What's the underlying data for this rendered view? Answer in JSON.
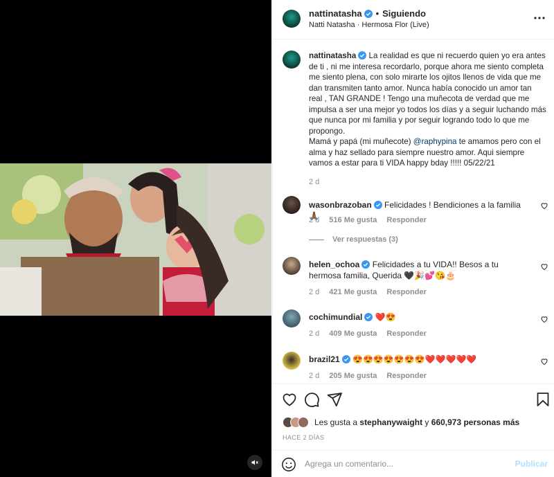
{
  "media": {
    "mute_icon": "speaker-muted-icon"
  },
  "header": {
    "username": "nattinatasha",
    "separator": "•",
    "follow_label": "Siguiendo",
    "audio": "Natti Natasha · Hermosa Flor (Live)",
    "more_icon": "more-horizontal-icon"
  },
  "caption": {
    "username": "nattinatasha",
    "text_before_mention": "La realidad es que ni recuerdo quien yo era antes de ti , ni me interesa recordarlo, porque ahora me siento completa me siento plena, con solo mirarte los ojitos llenos de vida que me dan transmiten tanto amor. Nunca había conocido un amor tan real , TAN GRANDE ! Tengo una muñecota de verdad que me impulsa a ser una mejor yo todos los días y a seguir luchando más que nunca por mi familia y por seguir logrando todo lo que me propongo.",
    "text_line2": "Mamá y papá (mi muñecote)",
    "mention": "@raphypina",
    "text_after_mention": "te amamos pero con el alma y haz sellado para siempre nuestro amor. Aqui siempre vamos a estar para ti VIDA happy bday !!!!! 05/22/21",
    "time": "2 d"
  },
  "comments": [
    {
      "username": "wasonbrazoban",
      "text": "Felicidades ! Bendiciones a la familia 🙏🏾",
      "time": "2 d",
      "likes": "516 Me gusta",
      "reply": "Responder"
    },
    {
      "username": "helen_ochoa",
      "text": "Felicidades a tu VIDA!! Besos a tu hermosa familia, Querida 🖤🎉💕😘🎂",
      "time": "2 d",
      "likes": "421 Me gusta",
      "reply": "Responder"
    },
    {
      "username": "cochimundial",
      "text": "❤️😍",
      "time": "2 d",
      "likes": "409 Me gusta",
      "reply": "Responder"
    },
    {
      "username": "brazil21",
      "text": "😍😍😍😍😍😍😍❤️❤️❤️❤️❤️",
      "time": "2 d",
      "likes": "205 Me gusta",
      "reply": "Responder"
    }
  ],
  "view_replies": "Ver respuestas (3)",
  "actions": {
    "like_icon": "heart-icon",
    "comment_icon": "comment-icon",
    "share_icon": "share-icon",
    "save_icon": "bookmark-icon"
  },
  "likes": {
    "prefix": "Les gusta a",
    "user": "stephanywaight",
    "connector": "y",
    "count": "660,973 personas más"
  },
  "time_ago": "HACE 2 DÍAS",
  "add_comment": {
    "placeholder": "Agrega un comentario...",
    "post_label": "Publicar",
    "emoji_icon": "smiley-icon"
  },
  "colors": {
    "verified": "#3897f0",
    "link": "#00376b",
    "secondary": "#8e8e8e",
    "post_disabled": "#b2dffc"
  }
}
